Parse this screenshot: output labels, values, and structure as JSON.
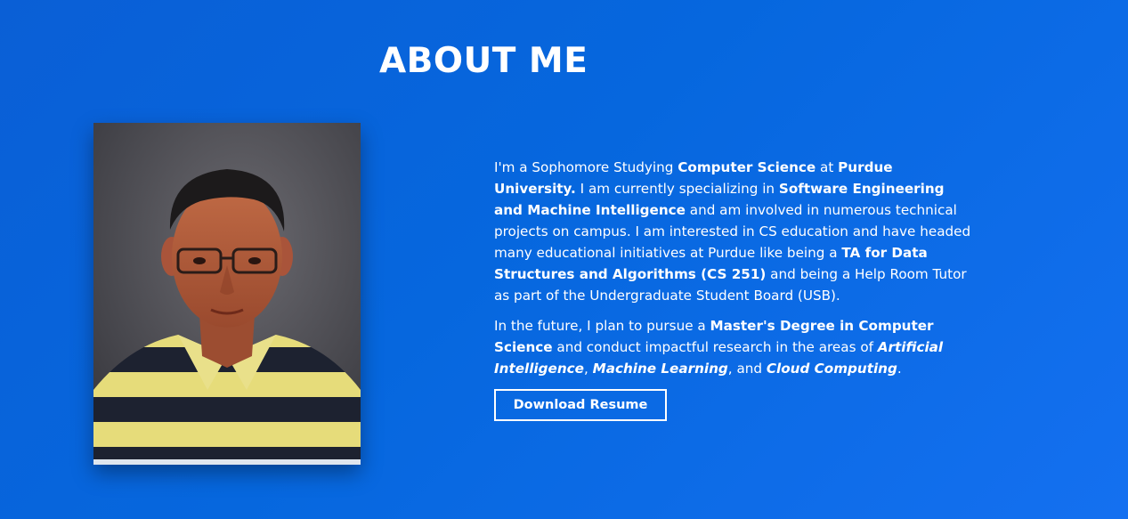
{
  "section": {
    "title": "ABOUT ME"
  },
  "photo": {
    "alt": "Portrait photo"
  },
  "bio": {
    "p1": {
      "t1": "I'm a Sophomore Studying ",
      "b1": "Computer Science",
      "t2": " at ",
      "b2": "Purdue University.",
      "t3": " I am currently specializing in ",
      "b3": "Software Engineering and Machine Intelligence",
      "t4": " and am involved in numerous technical projects on campus. I am interested in CS education and have headed many educational initiatives at Purdue like being a ",
      "b4": "TA for Data Structures and Algorithms (CS 251)",
      "t5": " and being a Help Room Tutor as part of the Undergraduate Student Board (USB)."
    },
    "p2": {
      "t1": "In the future, I plan to pursue a ",
      "b1": "Master's Degree in Computer Science",
      "t2": " and conduct impactful research in the areas of ",
      "i1": "Artificial Intelligence",
      "t3": ", ",
      "i2": "Machine Learning",
      "t4": ", and ",
      "i3": "Cloud Computing",
      "t5": "."
    }
  },
  "actions": {
    "download_resume": "Download Resume"
  },
  "colors": {
    "background_start": "#0a5fd6",
    "background_end": "#1470f0",
    "text": "#ffffff"
  }
}
